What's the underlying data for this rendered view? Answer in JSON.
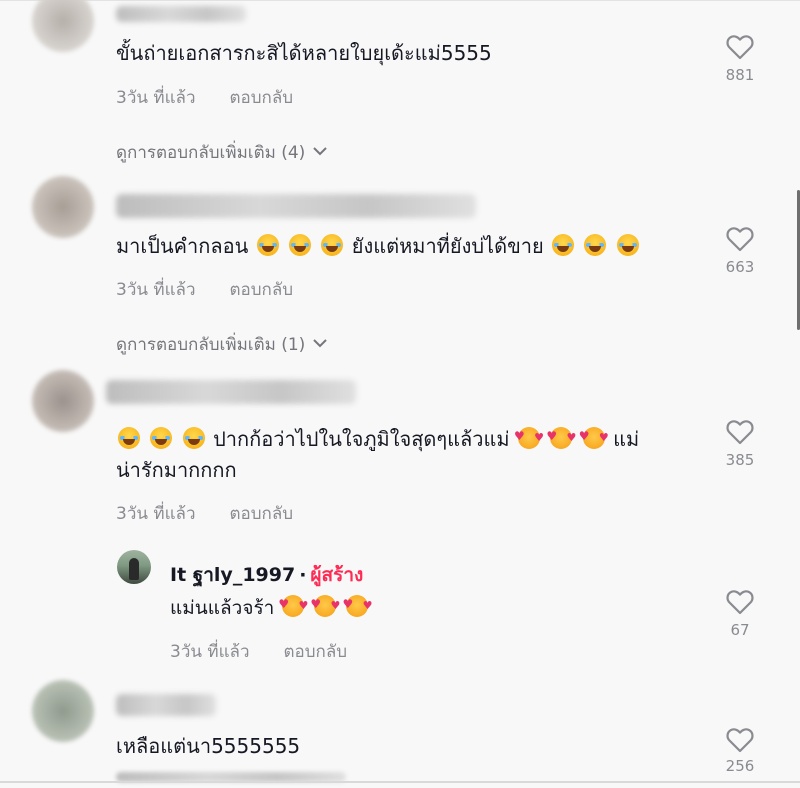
{
  "comments": [
    {
      "text": "ขั้นถ่ายเอกสารกะสิได้หลายใบยุเด้ะแม่5555",
      "time": "3วัน ที่แล้ว",
      "reply": "ตอบกลับ",
      "likes": "881",
      "more": "ดูการตอบกลับเพิ่มเติม (4)"
    },
    {
      "text_prefix": "มาเป็นคำกลอน",
      "text_middle": "ยังแต่หมาที่ยังบ่ได้ขาย",
      "time": "3วัน ที่แล้ว",
      "reply": "ตอบกลับ",
      "likes": "663",
      "more": "ดูการตอบกลับเพิ่มเติม (1)"
    },
    {
      "text_line1_a": "ปากก้อว่าไปในใจภูมิใจสุดๆแล้วแม่",
      "text_line1_b": "แม่",
      "text_line2": "น่ารักมากกกก",
      "time": "3วัน ที่แล้ว",
      "reply": "ตอบกลับ",
      "likes": "385",
      "creator_reply": {
        "username": "It ฐาly_1997",
        "separator": "·",
        "badge": "ผู้สร้าง",
        "text": "แม่นแล้วจร้า",
        "time": "3วัน ที่แล้ว",
        "reply": "ตอบกลับ",
        "likes": "67"
      }
    },
    {
      "text": "เหลือแต่นา5555555",
      "likes": "256"
    }
  ],
  "icons": {
    "like": "heart-outline-icon",
    "expand": "chevron-down-icon",
    "emoji_laugh": "face-with-tears-of-joy",
    "emoji_love": "smiling-face-with-hearts"
  },
  "colors": {
    "creator_badge": "#fe2c55",
    "meta_text": "#8a8b91",
    "background": "#f8f8f8"
  }
}
